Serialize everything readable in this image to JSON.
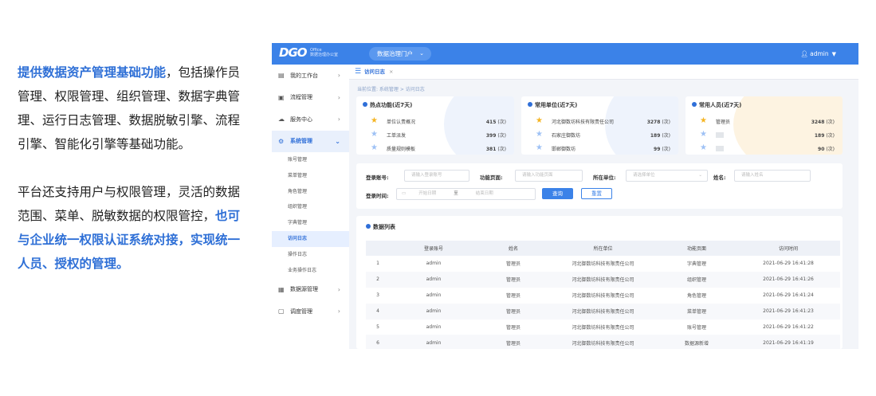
{
  "intro": {
    "p1_highlight": "提供数据资产管理基础功能",
    "p1_rest": "，包括操作员管理、权限管理、组织管理、数据字典管理、运行日志管理、数据脱敏引擎、流程引擎、智能化引擎等基础功能。",
    "p2_pre": "平台还支持用户与权限管理，灵活的数据范围、菜单、脱敏数据的权限管控，",
    "p2_highlight": "也可与企业统一权限认证系统对接，实现统一人员、授权的管理。"
  },
  "header": {
    "logo": "DGO",
    "logo_sub1": "Office",
    "logo_sub2": "数据治理办公室",
    "portal_label": "数据治理门户",
    "user_name": "admin"
  },
  "sidebar": {
    "items": [
      {
        "label": "我的工作台",
        "icon": "▤"
      },
      {
        "label": "流程管理",
        "icon": "▣"
      },
      {
        "label": "服务中心",
        "icon": "☁"
      },
      {
        "label": "系统管理",
        "icon": "⚙"
      },
      {
        "label": "数据源管理",
        "icon": "▦"
      },
      {
        "label": "调度管理",
        "icon": "▢"
      }
    ],
    "sub_items": [
      "账号管理",
      "菜单管理",
      "角色管理",
      "组织管理",
      "字典管理",
      "访问日志",
      "操作日志",
      "业务操作日志"
    ]
  },
  "tab": {
    "label": "访问日志",
    "close": "×"
  },
  "breadcrumb": "当前位置:  系统管理  >  访问日志",
  "stats": {
    "unit": "(次)",
    "hot_features": {
      "title": "热点功能(近7天)",
      "rows": [
        {
          "name": "单位认责概况",
          "value": "415"
        },
        {
          "name": "工单派发",
          "value": "399"
        },
        {
          "name": "质量规则模板",
          "value": "381"
        }
      ]
    },
    "top_units": {
      "title": "常用单位(近7天)",
      "rows": [
        {
          "name": "河北御数坊科技有限责任公司",
          "value": "3278"
        },
        {
          "name": "石家庄御数坊",
          "value": "189"
        },
        {
          "name": "邯郸御数坊",
          "value": "99"
        }
      ]
    },
    "top_users": {
      "title": "常用人员(近7天)",
      "rows": [
        {
          "name": "管理员",
          "value": "3248"
        },
        {
          "name": "",
          "value": "189"
        },
        {
          "name": "",
          "value": "90"
        }
      ]
    }
  },
  "search": {
    "account_label": "登录账号:",
    "account_placeholder": "请输入登录账号",
    "feature_label": "功能页面:",
    "feature_placeholder": "请输入功能页面",
    "unit_label": "所在单位:",
    "unit_placeholder": "请选择单位",
    "name_label": "姓名:",
    "name_placeholder": "请输入姓名",
    "time_label": "登录时间:",
    "start_placeholder": "开始日期",
    "range_sep": "至",
    "end_placeholder": "结束日期",
    "query_btn": "查询",
    "reset_btn": "重置"
  },
  "list": {
    "title": "数据列表",
    "columns": [
      "",
      "登录账号",
      "姓名",
      "所在单位",
      "功能页面",
      "访问时间"
    ],
    "rows": [
      [
        "1",
        "admin",
        "管理员",
        "河北御数坊科技有限责任公司",
        "字典管理",
        "2021-06-29 16:41:28"
      ],
      [
        "2",
        "admin",
        "管理员",
        "河北御数坊科技有限责任公司",
        "组织管理",
        "2021-06-29 16:41:26"
      ],
      [
        "3",
        "admin",
        "管理员",
        "河北御数坊科技有限责任公司",
        "角色管理",
        "2021-06-29 16:41:24"
      ],
      [
        "4",
        "admin",
        "管理员",
        "河北御数坊科技有限责任公司",
        "菜单管理",
        "2021-06-29 16:41:23"
      ],
      [
        "5",
        "admin",
        "管理员",
        "河北御数坊科技有限责任公司",
        "账号管理",
        "2021-06-29 16:41:22"
      ],
      [
        "6",
        "admin",
        "管理员",
        "河北御数坊科技有限责任公司",
        "数据源新增",
        "2021-06-29 16:41:19"
      ]
    ]
  },
  "colors": {
    "accent": "#3b82e8",
    "highlight_text": "#2e6fd6",
    "gold_star": "#f5b524",
    "blue_star": "#9ec1f5"
  }
}
